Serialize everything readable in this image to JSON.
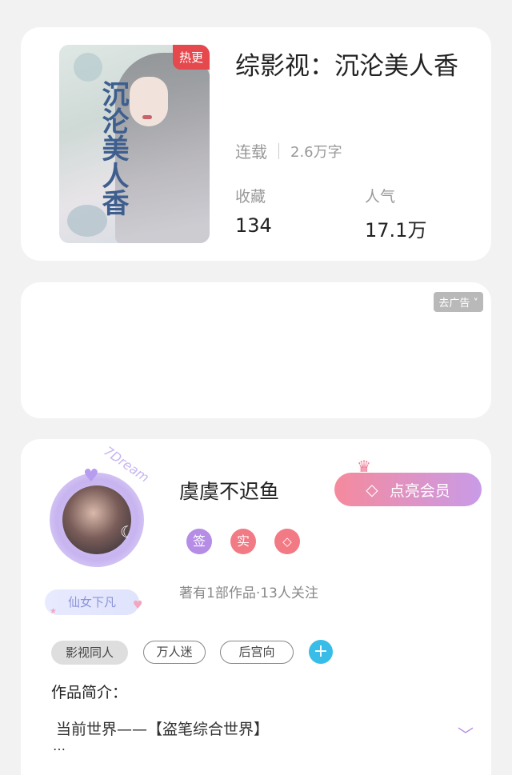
{
  "book": {
    "hot_badge": "热更",
    "cover_title": "沉沦美人香",
    "title": "综影视：沉沦美人香",
    "status": "连载",
    "word_count": "2.6万字",
    "favorites_label": "收藏",
    "favorites_value": "134",
    "popularity_label": "人气",
    "popularity_value": "17.1万"
  },
  "ad": {
    "remove_label": "去广告 ˅"
  },
  "author": {
    "name": "虞虞不迟鱼",
    "member_button": "点亮会员",
    "fairy_badge": "仙女下凡",
    "badge_sign": "签",
    "badge_real": "实",
    "badge_vip": "◇",
    "stats": "著有1部作品·13人关注",
    "avatar_deco_text": "7Dream"
  },
  "tags": [
    "影视同人",
    "万人迷",
    "后宫向"
  ],
  "intro": {
    "title": "作品简介：",
    "text": "当前世界——【盗笔综合世界】",
    "ellipsis": "…"
  },
  "colors": {
    "hot": "#e5484d",
    "member_gradient_start": "#f58a9d",
    "member_gradient_end": "#c99be8",
    "sign_badge": "#b58ce6",
    "add_tag": "#38bde8"
  }
}
